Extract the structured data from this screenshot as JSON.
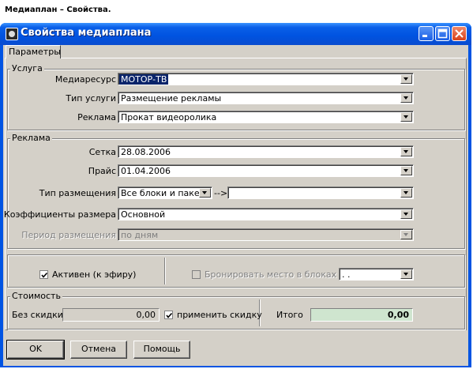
{
  "page_caption": "Медиаплан – Свойства.",
  "window": {
    "title": "Свойства медиаплана"
  },
  "tabs": [
    {
      "label": "Параметры"
    }
  ],
  "usluga": {
    "legend": "Услуга",
    "mediaresource": {
      "label": "Медиаресурс",
      "value": "МОТОР-ТВ"
    },
    "service_type": {
      "label": "Тип услуги",
      "value": "Размещение рекламы"
    },
    "advertising": {
      "label": "Реклама",
      "value": "Прокат видеоролика"
    }
  },
  "reklama": {
    "legend": "Реклама",
    "grid": {
      "label": "Сетка",
      "value": "28.08.2006"
    },
    "price": {
      "label": "Прайс",
      "value": "01.04.2006"
    },
    "placement_type": {
      "label": "Тип размещения",
      "value": "Все блоки и пакеті",
      "arrow": "-->",
      "value2": ""
    },
    "size_coefficients": {
      "label": "Коэффициенты размера",
      "value": "Основной"
    },
    "placement_period": {
      "label": "Период размещения",
      "value": "по дням"
    }
  },
  "status": {
    "active_label": "Активен (к эфиру)",
    "active_checked": true,
    "reserve_label": "Бронировать место в блоках до",
    "reserve_checked": false,
    "reserve_value": ". ."
  },
  "cost": {
    "legend": "Стоимость",
    "no_discount_label": "Без скидки",
    "no_discount_value": "0,00",
    "apply_discount_label": "применить скидку",
    "apply_discount_checked": true,
    "total_label": "Итого",
    "total_value": "0,00"
  },
  "buttons": {
    "ok": "OK",
    "cancel": "Отмена",
    "help": "Помощь"
  },
  "colors": {
    "title_bar": "#0054e3",
    "face": "#d4d0c8",
    "selection": "#0a246a",
    "total_bg": "#cfe5cf"
  }
}
